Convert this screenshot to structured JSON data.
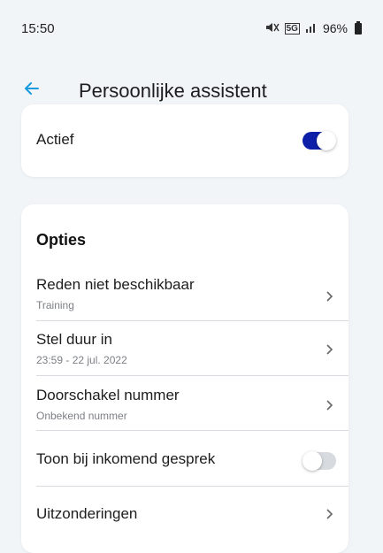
{
  "status_bar": {
    "time": "15:50",
    "network_label": "5G",
    "battery_percent": "96%"
  },
  "app_bar": {
    "title": "Persoonlijke assistent",
    "back_icon": "arrow-left-icon"
  },
  "active_card": {
    "label": "Actief",
    "toggle_on": true
  },
  "options": {
    "title": "Opties",
    "items": [
      {
        "label": "Reden niet beschikbaar",
        "sublabel": "Training"
      },
      {
        "label": "Stel duur in",
        "sublabel": "23:59 - 22 jul. 2022"
      },
      {
        "label": "Doorschakel nummer",
        "sublabel": "Onbekend nummer"
      },
      {
        "label": "Toon bij inkomend gesprek",
        "toggle_on": false
      },
      {
        "label": "Uitzonderingen"
      }
    ]
  },
  "colors": {
    "accent": "#0d1ea8",
    "back_arrow": "#1a9be0",
    "background": "#f1f5f8"
  }
}
